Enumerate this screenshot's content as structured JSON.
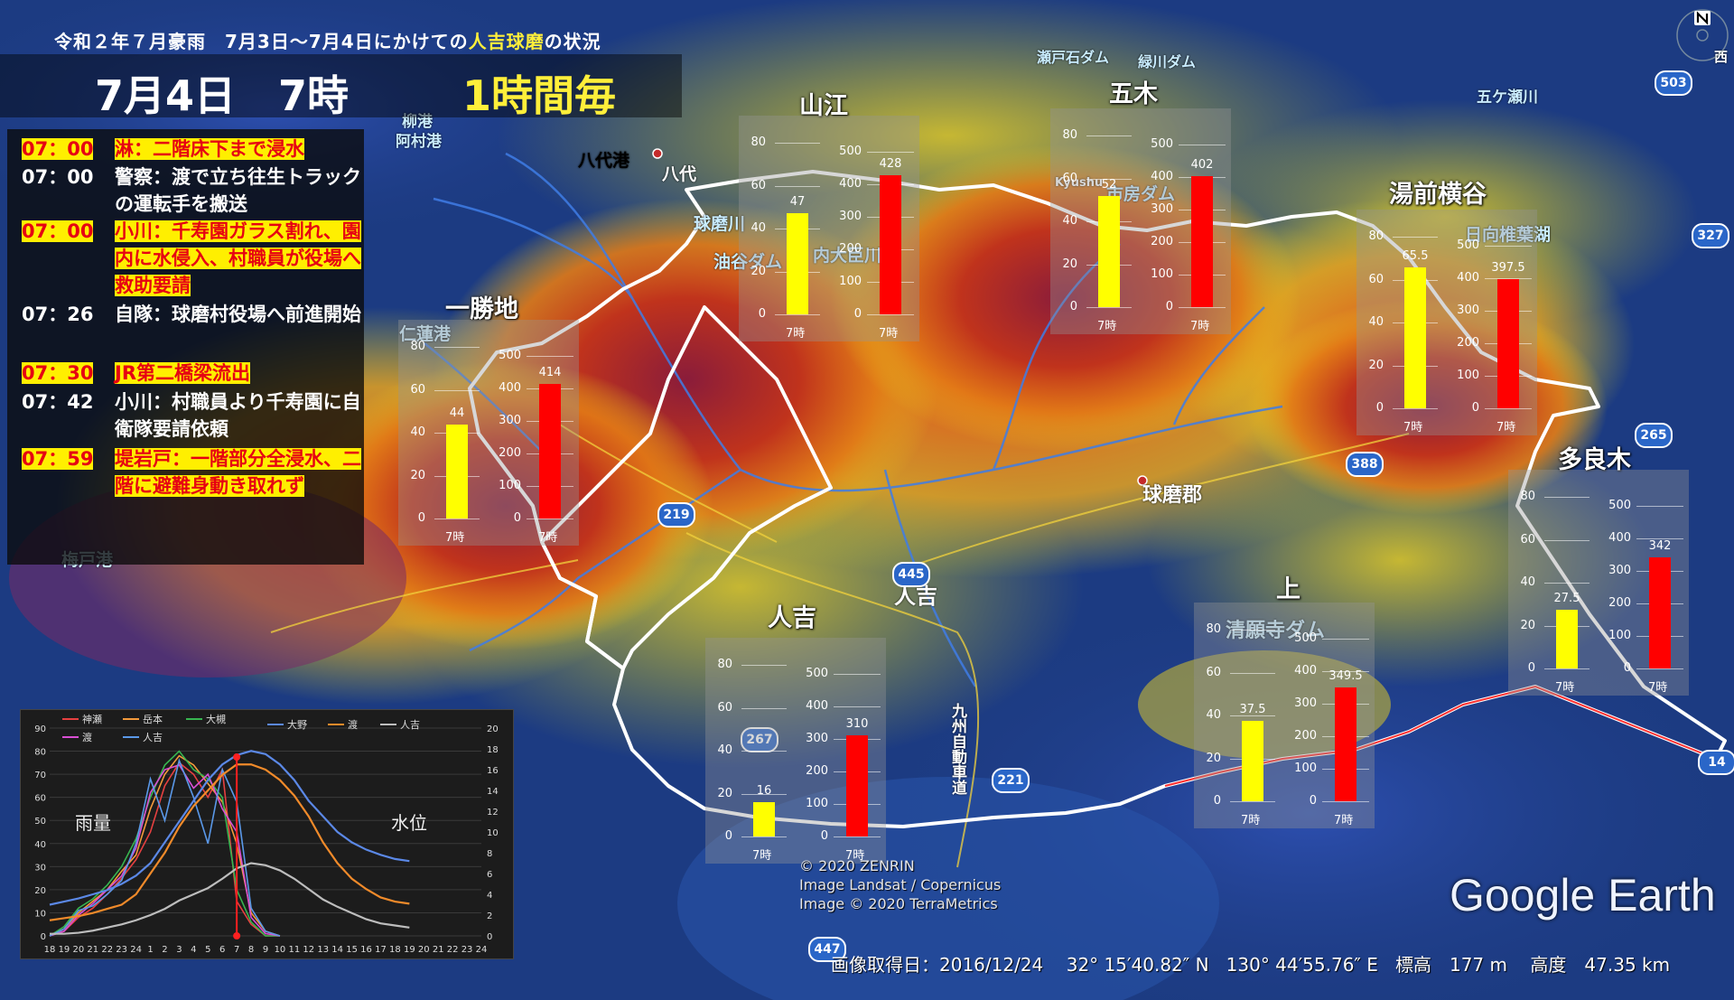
{
  "header": {
    "title_pre": "令和２年７月豪雨　7月3日～7月4日にかけての",
    "title_highlight": "人吉球磨",
    "title_post": "の状況",
    "date": "7月4日",
    "hour": "7時",
    "interval": "1時間毎"
  },
  "events": [
    {
      "time": "07：00",
      "text": "淋：二階床下まで浸水",
      "highlight": true
    },
    {
      "time": "07：00",
      "text": "警察：渡で立ち往生トラックの運転手を搬送",
      "highlight": false
    },
    {
      "time": "07：00",
      "text": "小川：千寿園ガラス割れ、園内に水侵入、村職員が役場へ救助要請",
      "highlight": true
    },
    {
      "time": "07：26",
      "text": "自隊：球磨村役場へ前進開始",
      "highlight": false
    },
    {
      "time": "07：30",
      "text": "JR第二橋梁流出",
      "highlight": true
    },
    {
      "time": "07：42",
      "text": "小川：村職員より千寿園に自衛隊要請依頼",
      "highlight": false
    },
    {
      "time": "07：59",
      "text": "堤岩戸：一階部分全浸水、二階に避難身動き取れず",
      "highlight": true
    }
  ],
  "stations": [
    {
      "name": "山江",
      "rain": 47,
      "level": 428,
      "rain_axis": [
        "80",
        "60",
        "40",
        "20",
        "0"
      ],
      "level_axis": [
        "500",
        "400",
        "300",
        "200",
        "100",
        "0"
      ],
      "time_label": "7時"
    },
    {
      "name": "五木",
      "rain": 52,
      "level": 402,
      "rain_axis": [
        "80",
        "60",
        "40",
        "20",
        "0"
      ],
      "level_axis": [
        "500",
        "400",
        "300",
        "200",
        "100",
        "0"
      ],
      "time_label": "7時"
    },
    {
      "name": "湯前横谷",
      "rain": 65.5,
      "level": 397.5,
      "rain_axis": [
        "80",
        "60",
        "40",
        "20",
        "0"
      ],
      "level_axis": [
        "500",
        "400",
        "300",
        "200",
        "100",
        "0"
      ],
      "time_label": "7時"
    },
    {
      "name": "一勝地",
      "rain": 44,
      "level": 414,
      "rain_axis": [
        "80",
        "60",
        "40",
        "20",
        "0"
      ],
      "level_axis": [
        "500",
        "400",
        "300",
        "200",
        "100",
        "0"
      ],
      "time_label": "7時"
    },
    {
      "name": "多良木",
      "rain": 27.5,
      "level": 342,
      "rain_axis": [
        "80",
        "60",
        "40",
        "20",
        "0"
      ],
      "level_axis": [
        "500",
        "400",
        "300",
        "200",
        "100",
        "0"
      ],
      "time_label": "7時"
    },
    {
      "name": "人吉",
      "rain": 16,
      "level": 310,
      "rain_axis": [
        "80",
        "60",
        "40",
        "20",
        "0"
      ],
      "level_axis": [
        "500",
        "400",
        "300",
        "200",
        "100",
        "0"
      ],
      "time_label": "7時"
    },
    {
      "name": "上",
      "rain": 37.5,
      "level": 349.5,
      "rain_axis": [
        "80",
        "60",
        "40",
        "20",
        "0"
      ],
      "level_axis": [
        "500",
        "400",
        "300",
        "200",
        "100",
        "0"
      ],
      "time_label": "7時"
    }
  ],
  "colors": {
    "rain_bar": "#ffff00",
    "level_bar": "#ff0000",
    "boundary": "#ffffff",
    "highlight_bg": "#ffef00",
    "highlight_text": "#e60012"
  },
  "map_labels": [
    {
      "text": "八代港",
      "color": "#c9ecff"
    },
    {
      "text": "八代",
      "color": "#ffffff"
    },
    {
      "text": "球磨郡",
      "color": "#ffffff"
    },
    {
      "text": "人吉",
      "color": "#ffffff"
    },
    {
      "text": "日向椎葉湖",
      "color": "#c9ecff"
    },
    {
      "text": "五ケ瀬川",
      "color": "#c9ecff"
    },
    {
      "text": "梅戸港",
      "color": "#c9ecff"
    },
    {
      "text": "球磨川",
      "color": "#c9ecff"
    },
    {
      "text": "九州自動車道",
      "color": "#ffffff"
    },
    {
      "text": "清願寺ダム",
      "color": "#c9ecff"
    },
    {
      "text": "瀬戸石ダム",
      "color": "#c9ecff"
    },
    {
      "text": "緑川ダム",
      "color": "#c9ecff"
    },
    {
      "text": "市房ダム",
      "color": "#c9ecff"
    },
    {
      "text": "内大臣川",
      "color": "#c9ecff"
    },
    {
      "text": "油谷ダム",
      "color": "#c9ecff"
    },
    {
      "text": "仁蓮港",
      "color": "#c9ecff"
    },
    {
      "text": "柳港",
      "color": "#c9ecff"
    },
    {
      "text": "阿村港",
      "color": "#c9ecff"
    },
    {
      "text": "Kyushu",
      "color": "#ffffff"
    },
    {
      "text": "西",
      "color": "#ffffff"
    }
  ],
  "routes": [
    "219",
    "445",
    "388",
    "265",
    "267",
    "221",
    "447",
    "327",
    "503",
    "14"
  ],
  "credits": [
    "© 2020 ZENRIN",
    "Image Landsat / Copernicus",
    "Image © 2020 TerraMetrics"
  ],
  "status_bar": {
    "date_label": "画像取得日：2016/12/24",
    "lat": "32° 15′40.82″ N",
    "lon": "130° 44′55.76″ E",
    "elev": "標高　177 m",
    "alt": "高度　47.35 km"
  },
  "ge_logo": "Google Earth",
  "chart_data": {
    "type": "line",
    "x": [
      "18",
      "19",
      "20",
      "21",
      "22",
      "23",
      "24",
      "1",
      "2",
      "3",
      "4",
      "5",
      "6",
      "7",
      "8",
      "9",
      "10",
      "11",
      "12",
      "13",
      "14",
      "15",
      "16",
      "17",
      "18",
      "19",
      "20",
      "21",
      "22",
      "23",
      "24"
    ],
    "left_axis": {
      "label": "雨量",
      "ticks": [
        "90",
        "80",
        "70",
        "60",
        "50",
        "40",
        "30",
        "20",
        "10",
        "0"
      ],
      "ylim": [
        0,
        90
      ]
    },
    "right_axis": {
      "label": "水位",
      "ticks": [
        "20",
        "18",
        "16",
        "14",
        "12",
        "10",
        "8",
        "6",
        "4",
        "2",
        "0"
      ],
      "ylim": [
        0,
        20
      ]
    },
    "series": [
      {
        "name": "神瀬",
        "color": "#e64040",
        "axis": "left",
        "values": [
          0,
          2,
          8,
          12,
          18,
          25,
          33,
          45,
          65,
          75,
          70,
          60,
          72,
          15,
          5,
          0,
          0
        ]
      },
      {
        "name": "岳本",
        "color": "#f39a3c",
        "axis": "left",
        "values": [
          0,
          3,
          10,
          15,
          20,
          28,
          35,
          55,
          70,
          78,
          74,
          66,
          58,
          40,
          10,
          2,
          0
        ]
      },
      {
        "name": "大槻",
        "color": "#37b550",
        "axis": "left",
        "values": [
          0,
          4,
          12,
          16,
          22,
          30,
          42,
          60,
          74,
          80,
          72,
          68,
          60,
          20,
          6,
          0,
          0
        ]
      },
      {
        "name": "渡",
        "color": "#d94fd4",
        "axis": "left",
        "values": [
          0,
          2,
          9,
          14,
          20,
          26,
          38,
          62,
          72,
          74,
          64,
          70,
          55,
          45,
          8,
          1,
          0
        ]
      },
      {
        "name": "人吉",
        "color": "#5a98e8",
        "axis": "left",
        "values": [
          0,
          3,
          11,
          13,
          18,
          24,
          40,
          68,
          50,
          76,
          60,
          40,
          72,
          58,
          12,
          2,
          0
        ]
      },
      {
        "name": "大野",
        "color": "#5b88e6",
        "axis": "right",
        "values": [
          3,
          3.3,
          3.6,
          4,
          4.4,
          5,
          5.8,
          7,
          9,
          11,
          13,
          15,
          16.5,
          17.4,
          17.8,
          17.5,
          16.5,
          15,
          13,
          11.5,
          10,
          9,
          8.3,
          7.8,
          7.4,
          7.2
        ]
      },
      {
        "name": "渡",
        "color": "#f08a2a",
        "axis": "right",
        "values": [
          1.5,
          1.7,
          1.9,
          2.2,
          2.6,
          3,
          4,
          6,
          8,
          10.5,
          12.5,
          14,
          15.5,
          16.5,
          16.5,
          16,
          15,
          13.5,
          11.5,
          9,
          7,
          5.5,
          4.5,
          3.7,
          3.3,
          3.1
        ]
      },
      {
        "name": "人吉",
        "color": "#bdbdbd",
        "axis": "right",
        "values": [
          0.2,
          0.2,
          0.3,
          0.5,
          0.8,
          1.1,
          1.5,
          2,
          2.6,
          3.4,
          4,
          4.6,
          5.5,
          6.5,
          7,
          6.8,
          6.3,
          5.5,
          4.5,
          3.5,
          2.8,
          2.2,
          1.6,
          1.2,
          1,
          0.8
        ]
      }
    ],
    "marker_x": "7"
  }
}
